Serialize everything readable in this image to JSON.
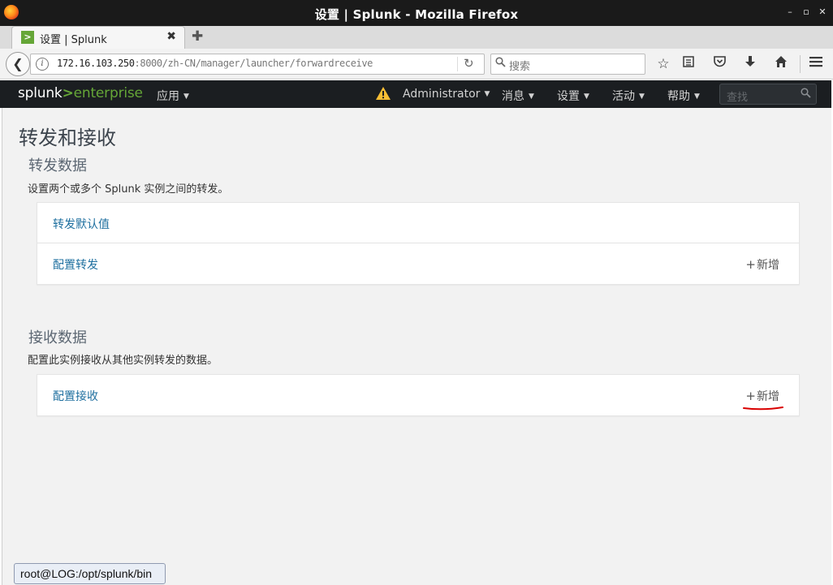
{
  "window": {
    "title": "设置 |  Splunk - Mozilla Firefox",
    "minimize": "–",
    "maximize": "▫",
    "close": "✕"
  },
  "tab": {
    "title": "设置 |  Splunk",
    "favicon": ">",
    "close": "✖",
    "new_tab": "✚"
  },
  "navbar": {
    "url_host": "172.16.103.250",
    "url_path": ":8000/zh-CN/manager/launcher/forwardreceive",
    "search_placeholder": "搜索"
  },
  "splunk_header": {
    "logo_splunk": "splunk",
    "logo_gt": ">",
    "logo_enterprise": "enterprise",
    "nav": [
      {
        "label": "应用"
      },
      {
        "label": "Administrator"
      },
      {
        "label": "消息"
      },
      {
        "label": "设置"
      },
      {
        "label": "活动"
      },
      {
        "label": "帮助"
      }
    ],
    "search_placeholder": "查找"
  },
  "page": {
    "title": "转发和接收",
    "forward": {
      "title": "转发数据",
      "desc": "设置两个或多个 Splunk 实例之间的转发。",
      "rows": [
        {
          "link": "转发默认值",
          "add": ""
        },
        {
          "link": "配置转发",
          "add": "新增"
        }
      ]
    },
    "receive": {
      "title": "接收数据",
      "desc": "配置此实例接收从其他实例转发的数据。",
      "rows": [
        {
          "link": "配置接收",
          "add": "新增"
        }
      ]
    },
    "add_plus": "+"
  },
  "terminal_tooltip": "root@LOG:/opt/splunk/bin",
  "colors": {
    "splunk_green": "#65a637",
    "link_blue": "#1e6f9f",
    "header_bg": "#1b1e21",
    "warning_yellow": "#f8be34",
    "annotation_red": "#d90000"
  }
}
